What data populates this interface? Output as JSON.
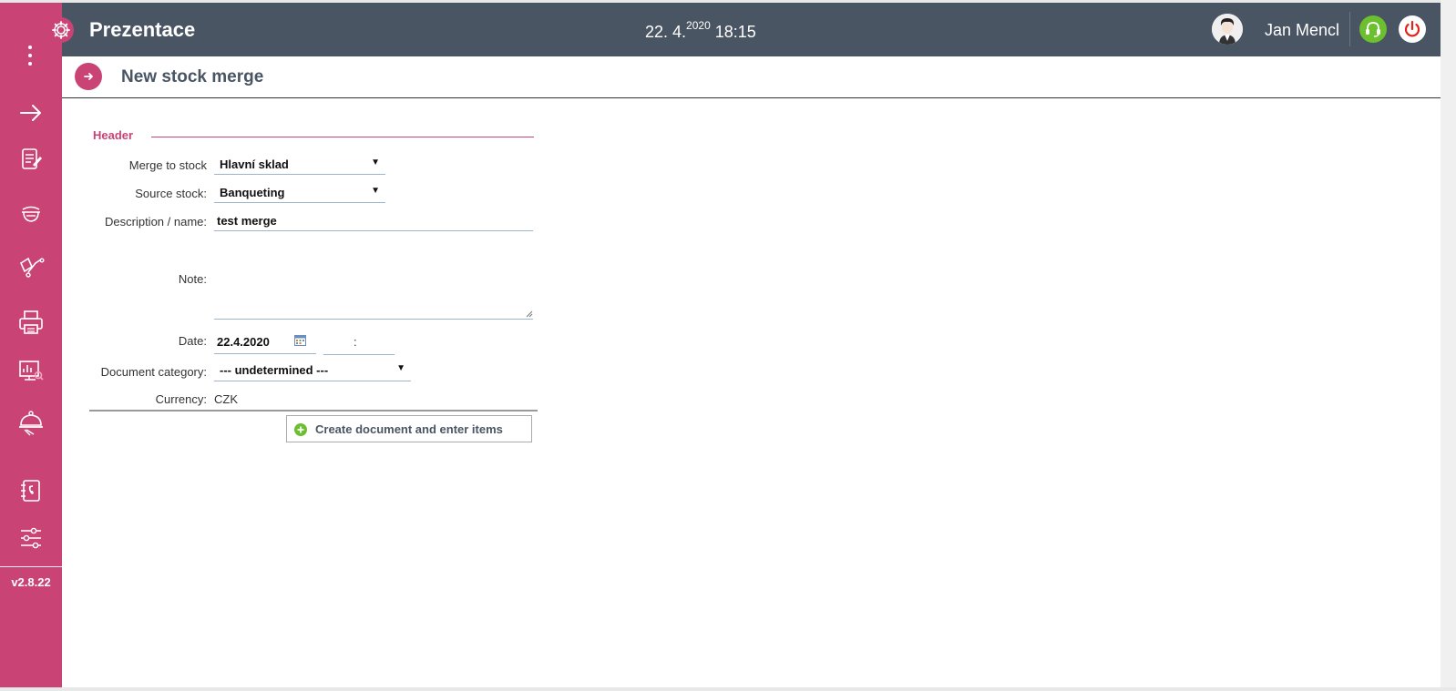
{
  "app": {
    "title": "Prezentace",
    "date": "22. 4.",
    "year": "2020",
    "time": "18:15",
    "user": "Jan Mencl"
  },
  "sidebar": {
    "items": [
      {
        "label": "Stock items",
        "icon": "stock-items-icon"
      },
      {
        "label": "Recipes",
        "icon": "recipes-icon"
      },
      {
        "label": "Stock",
        "icon": "stock-icon"
      },
      {
        "label": "ePOS",
        "icon": "printer-icon"
      },
      {
        "label": "Reportings",
        "icon": "reportings-icon"
      },
      {
        "label": "Banquet /",
        "label2": "Breakfast",
        "icon": "cloche-icon"
      },
      {
        "label": "Address book",
        "icon": "address-book-icon"
      },
      {
        "label": "Settings",
        "icon": "sliders-icon"
      }
    ],
    "version": "v2.8.22"
  },
  "page": {
    "title": "New stock merge"
  },
  "form": {
    "section": "Header",
    "merge_to_stock": {
      "label": "Merge to stock",
      "value": "Hlavní sklad"
    },
    "source_stock": {
      "label": "Source stock:",
      "value": "Banqueting"
    },
    "description": {
      "label": "Description / name:",
      "value": "test merge"
    },
    "note": {
      "label": "Note:",
      "value": ""
    },
    "date": {
      "label": "Date:",
      "value": "22.4.2020",
      "time_sep": ":"
    },
    "category": {
      "label": "Document category:",
      "value": "--- undetermined ---"
    },
    "currency": {
      "label": "Currency:",
      "value": "CZK"
    },
    "submit_label": "Create document and enter items"
  },
  "colors": {
    "accent": "#c94474",
    "topbar": "#4a5563",
    "support": "#6cbf2f"
  }
}
